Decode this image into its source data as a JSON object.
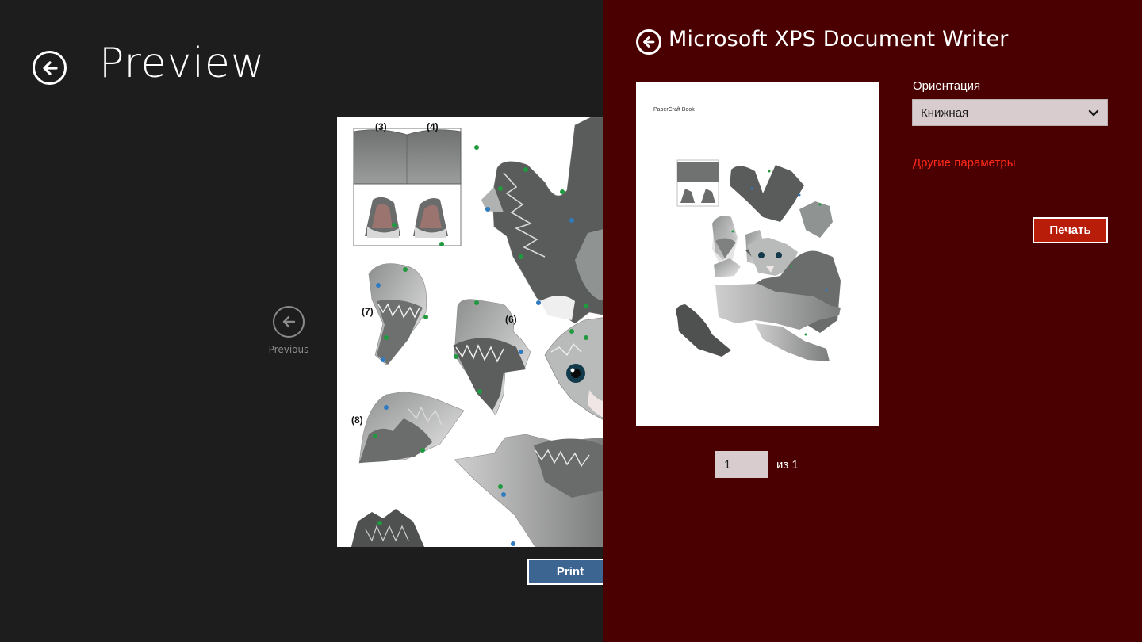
{
  "app": {
    "title": "Preview"
  },
  "nav": {
    "previous_label": "Previous"
  },
  "preview": {
    "part_labels": [
      "(3)",
      "(4)",
      "(7)",
      "(6)",
      "(8)"
    ],
    "print_label": "Print"
  },
  "print_panel": {
    "device_name": "Microsoft XPS Document Writer",
    "thumbnail_header": "PaperCraft Book",
    "orientation_label": "Ориентация",
    "orientation_value": "Книжная",
    "more_settings_link": "Другие параметры",
    "print_button": "Печать",
    "page_current": "1",
    "page_of": "из 1"
  },
  "icons": {
    "back": "arrow-left-circle-icon",
    "previous": "arrow-left-circle-icon",
    "dropdown": "chevron-down-icon"
  },
  "colors": {
    "left_background": "#1d1d1d",
    "panel_background": "#4a0000",
    "print_button": "#3d6592",
    "pechat_button": "#b81d0a",
    "link": "#ff2a1a"
  }
}
